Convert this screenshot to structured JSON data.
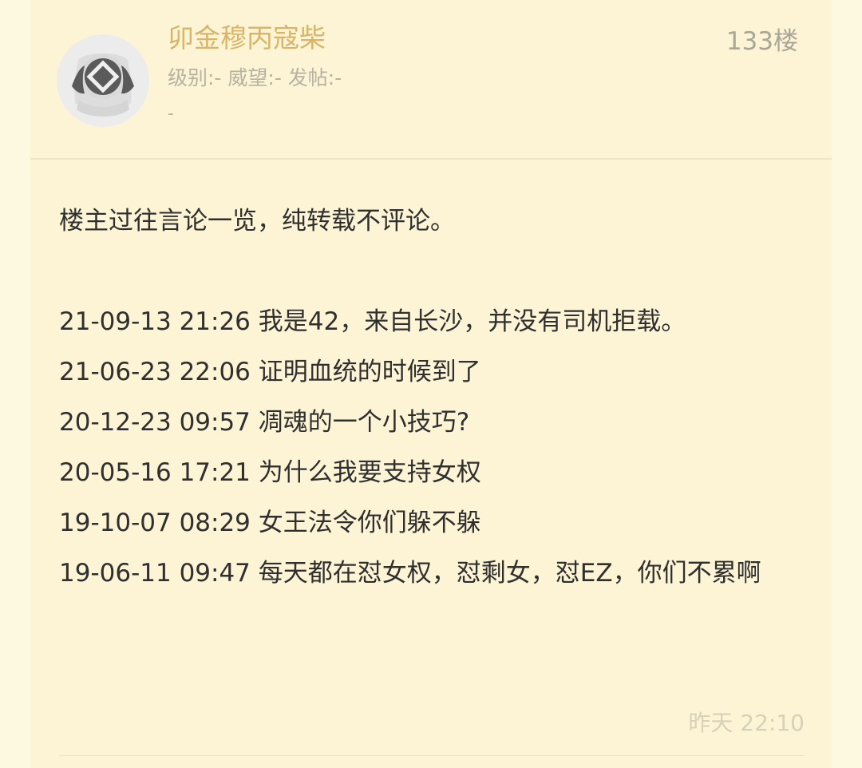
{
  "post": {
    "username": "卯金穆丙寇柴",
    "meta": "级别:-  威望:-  发帖:-",
    "meta2": "-",
    "floor": "133楼",
    "avatar_icon": "diving-helmet-icon",
    "intro": "楼主过往言论一览，纯转载不评论。",
    "lines": [
      "21-09-13 21:26 我是42，来自长沙，并没有司机拒载。",
      "21-06-23 22:06 证明血统的时候到了",
      "20-12-23 09:57 凋魂的一个小技巧?",
      "20-05-16 17:21 为什么我要支持女权",
      "19-10-07 08:29 女王法令你们躲不躲",
      "19-06-11 09:47 每天都在怼女权，怼剩女，怼EZ，你们不累啊"
    ],
    "time": "昨天 22:10"
  },
  "colors": {
    "page_bg": "#fdf8e0",
    "card_bg": "#fcf4d4",
    "username": "#d8b56a",
    "meta": "#b7b2a2",
    "text": "#2f2f2f",
    "muted": "#d8d1ba"
  }
}
